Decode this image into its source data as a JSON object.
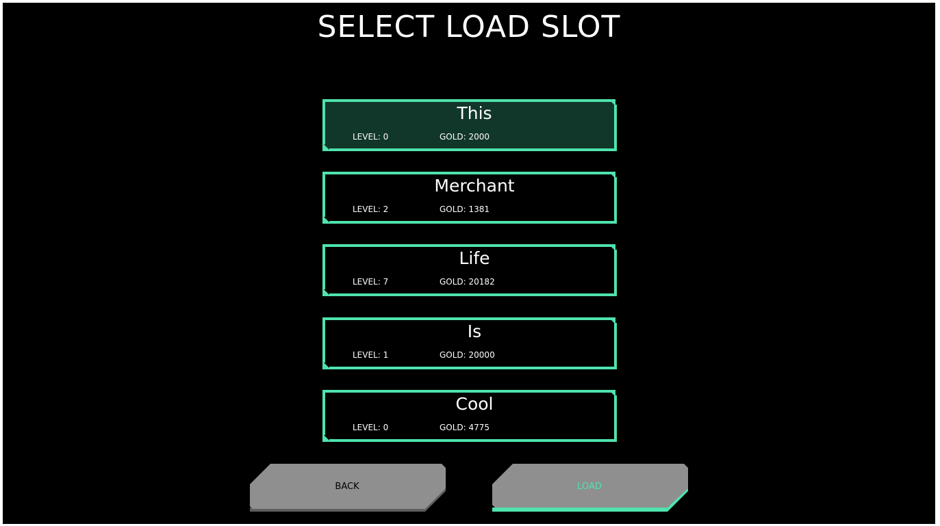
{
  "screen": {
    "title": "SELECT LOAD SLOT"
  },
  "slots": [
    {
      "name": "This",
      "level": "LEVEL: 0",
      "gold": "GOLD: 2000",
      "selected": true
    },
    {
      "name": "Merchant",
      "level": "LEVEL: 2",
      "gold": "GOLD: 1381",
      "selected": false
    },
    {
      "name": "Life",
      "level": "LEVEL: 7",
      "gold": "GOLD: 20182",
      "selected": false
    },
    {
      "name": "Is",
      "level": "LEVEL: 1",
      "gold": "GOLD: 20000",
      "selected": false
    },
    {
      "name": "Cool",
      "level": "LEVEL: 0",
      "gold": "GOLD: 4775",
      "selected": false
    }
  ],
  "buttons": {
    "back_label": "BACK",
    "load_label": "LOAD"
  },
  "colors": {
    "accent": "#4fe3ad",
    "selected_fill": "#11372a",
    "button_fill": "#8f8f8f",
    "button_shadow": "#5d5d5d",
    "background": "#000000"
  }
}
